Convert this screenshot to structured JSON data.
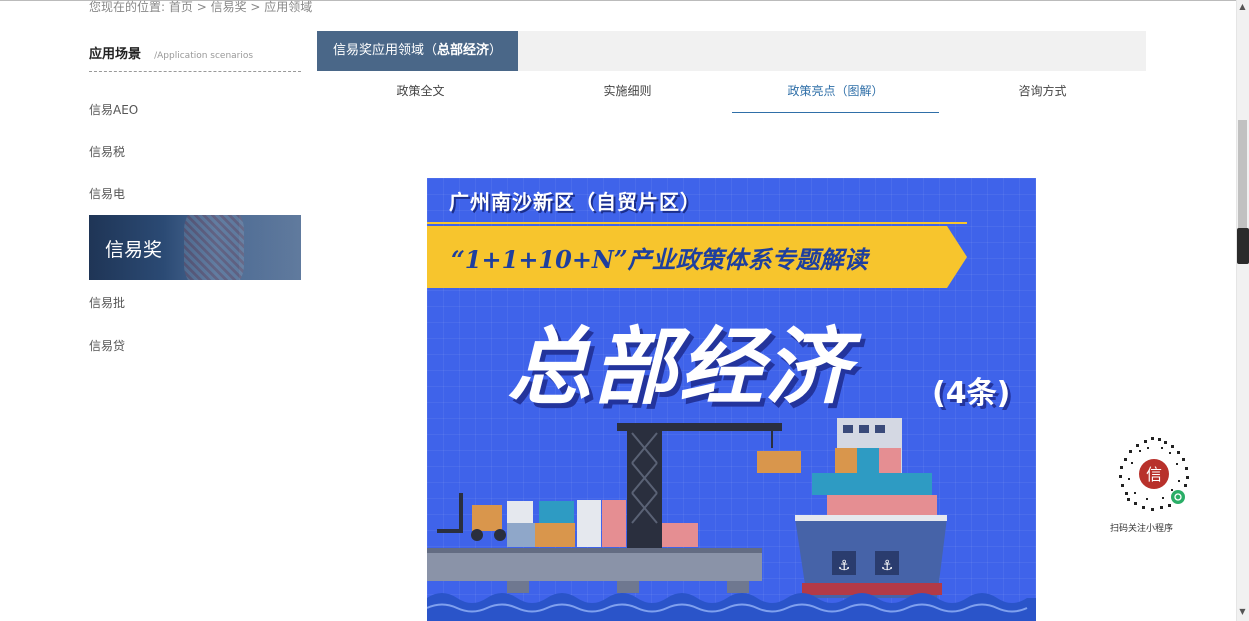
{
  "breadcrumb": {
    "prefix": "您现在的位置:",
    "items": [
      "首页",
      "信易奖",
      "应用领域"
    ],
    "sep1": " > ",
    "sep2": " > "
  },
  "sidebar": {
    "title": "应用场景",
    "subtitle": "/Application scenarios",
    "items": [
      {
        "label": "信易AEO"
      },
      {
        "label": "信易税"
      },
      {
        "label": "信易电"
      },
      {
        "label": "信易奖"
      },
      {
        "label": "信易批"
      },
      {
        "label": "信易贷"
      }
    ],
    "active_index": 3
  },
  "main": {
    "header_prefix": "信易奖应用领域（",
    "header_bold": "总部经济",
    "header_suffix": "）",
    "tabs": [
      {
        "label": "政策全文"
      },
      {
        "label": "实施细则"
      },
      {
        "label": "政策亮点（图解）"
      },
      {
        "label": "咨询方式"
      }
    ],
    "active_tab": 2
  },
  "poster": {
    "top_line": "广州南沙新区（自贸片区）",
    "banner": "“1+1+10+N”产业政策体系专题解读",
    "title": "总部经济",
    "count": "(4条)",
    "colors": {
      "background": "#3f63ea",
      "banner": "#f7c52d",
      "banner_text": "#1e3f9e"
    }
  },
  "qr": {
    "label": "扫码关注小程序",
    "icon": "mini-program-qr-icon"
  },
  "colors": {
    "accent": "#2f6fa8",
    "header_tab": "#4a6788"
  }
}
